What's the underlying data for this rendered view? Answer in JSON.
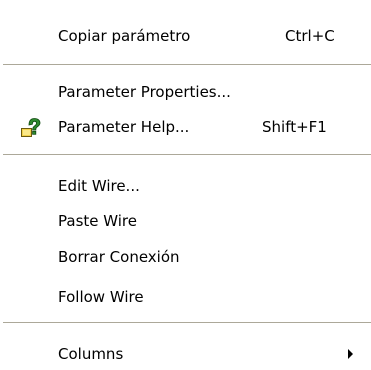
{
  "menu": {
    "items": [
      {
        "label": "Copiar parámetro",
        "shortcut": "Ctrl+C"
      },
      {
        "label": "Parameter Properties..."
      },
      {
        "label": "Parameter Help...",
        "shortcut": "Shift+F1",
        "icon": "help-icon"
      },
      {
        "label": "Edit Wire..."
      },
      {
        "label": "Paste Wire"
      },
      {
        "label": "Borrar Conexión"
      },
      {
        "label": "Follow Wire"
      },
      {
        "label": "Columns",
        "icon": "submenu-arrow-icon"
      }
    ]
  },
  "colors": {
    "background": "#ffffff",
    "separator_dark": "#aca899",
    "text": "#000000"
  }
}
